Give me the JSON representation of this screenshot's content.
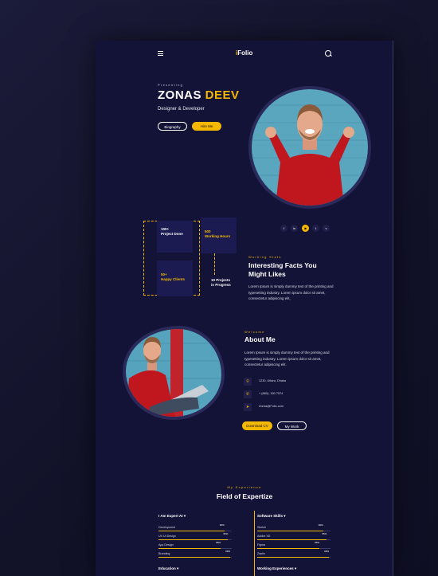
{
  "header": {
    "logo_prefix": "i",
    "logo_main": "Folio"
  },
  "hero": {
    "presenting": "Presenting",
    "first_name": "ZONAS",
    "last_name": "DEEV",
    "role": "Designer & Developer",
    "btn_biography": "Biography",
    "btn_hire": "Hire Me"
  },
  "social": [
    "f",
    "in",
    "◉",
    "t",
    "v"
  ],
  "facts": {
    "box1_num": "100+",
    "box1_label": "Project Done",
    "box2_num": "500",
    "box2_label": "Working Hours",
    "box3_num": "50+",
    "box3_label": "Happy Clients",
    "box4_num": "10 Projects",
    "box4_label": "in Progress",
    "kicker": "Working Stats",
    "title_line1": "Interesting Facts  You",
    "title_line2": "Might Likes",
    "text": "Lorem Ipsum is simply dummy text of the printing and typesetting industry. Lorem ipsum dolor sit amet, consectetur adipiscing elit,"
  },
  "about": {
    "kicker": "Welcome",
    "title": "About Me",
    "text": "Lorem Ipsum is simply dummy text of the printing and typesetting industry. Lorem ipsum dolor sit amet, consectetur adipiscing elit.",
    "address": "1230, Uttara, Dhaka",
    "phone": "+ (880)- 300 7574",
    "email": "Zonas@Folio.com",
    "btn_download": "Download CV",
    "btn_work": "My Work"
  },
  "expertise": {
    "kicker": "My Experience",
    "title": "Field of Expertize",
    "left_head": "I Am Expert At",
    "right_head": "Software Skills",
    "left_skills": [
      {
        "name": "Development",
        "pct": "90%",
        "value": 90
      },
      {
        "name": "UX UI Design",
        "pct": "95%",
        "value": 95
      },
      {
        "name": "App Design",
        "pct": "85%",
        "value": 85
      },
      {
        "name": "Branding",
        "pct": "98%",
        "value": 98
      }
    ],
    "right_skills": [
      {
        "name": "Sketch",
        "pct": "90%",
        "value": 90
      },
      {
        "name": "Adobe XD",
        "pct": "95%",
        "value": 95
      },
      {
        "name": "Figma",
        "pct": "85%",
        "value": 85
      },
      {
        "name": "Zeplin",
        "pct": "98%",
        "value": 98
      }
    ],
    "left_head2": "Education",
    "right_head2": "Working Experiences"
  },
  "colors": {
    "accent": "#f5b800",
    "background": "#131338",
    "box": "#1b1b52"
  }
}
